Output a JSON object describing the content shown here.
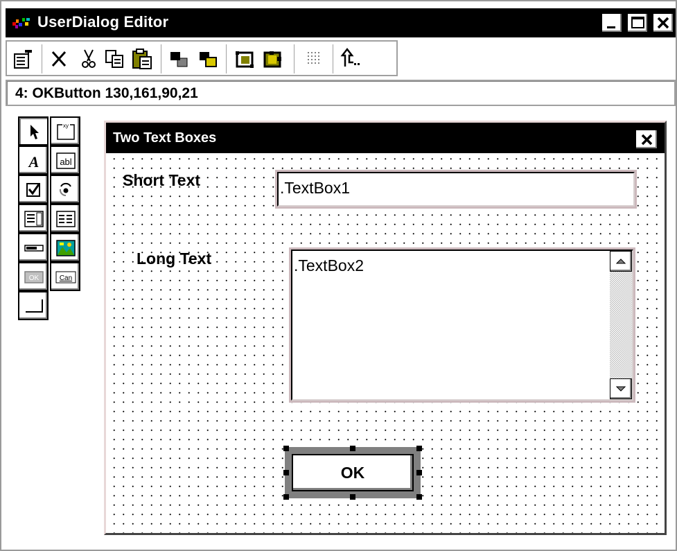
{
  "window": {
    "title": "UserDialog Editor"
  },
  "status": {
    "text": "4: OKButton 130,161,90,21"
  },
  "toolbar": {
    "buttons": [
      "properties",
      "delete",
      "cut",
      "copy",
      "paste",
      "send-to-back",
      "bring-to-front",
      "group",
      "ungroup",
      "grid",
      "run-dialog"
    ]
  },
  "toolbox": {
    "tools": [
      "pointer",
      "groupbox",
      "text",
      "textbox",
      "checkbox",
      "optionbutton",
      "listbox",
      "droplistbox",
      "combobox",
      "picture",
      "okbutton",
      "cancelbutton",
      "pushbutton"
    ]
  },
  "dialog": {
    "title": "Two Text Boxes",
    "short_label": "Short Text",
    "long_label": "Long Text",
    "textbox1": ".TextBox1",
    "textbox2": ".TextBox2",
    "ok_label": "OK"
  }
}
